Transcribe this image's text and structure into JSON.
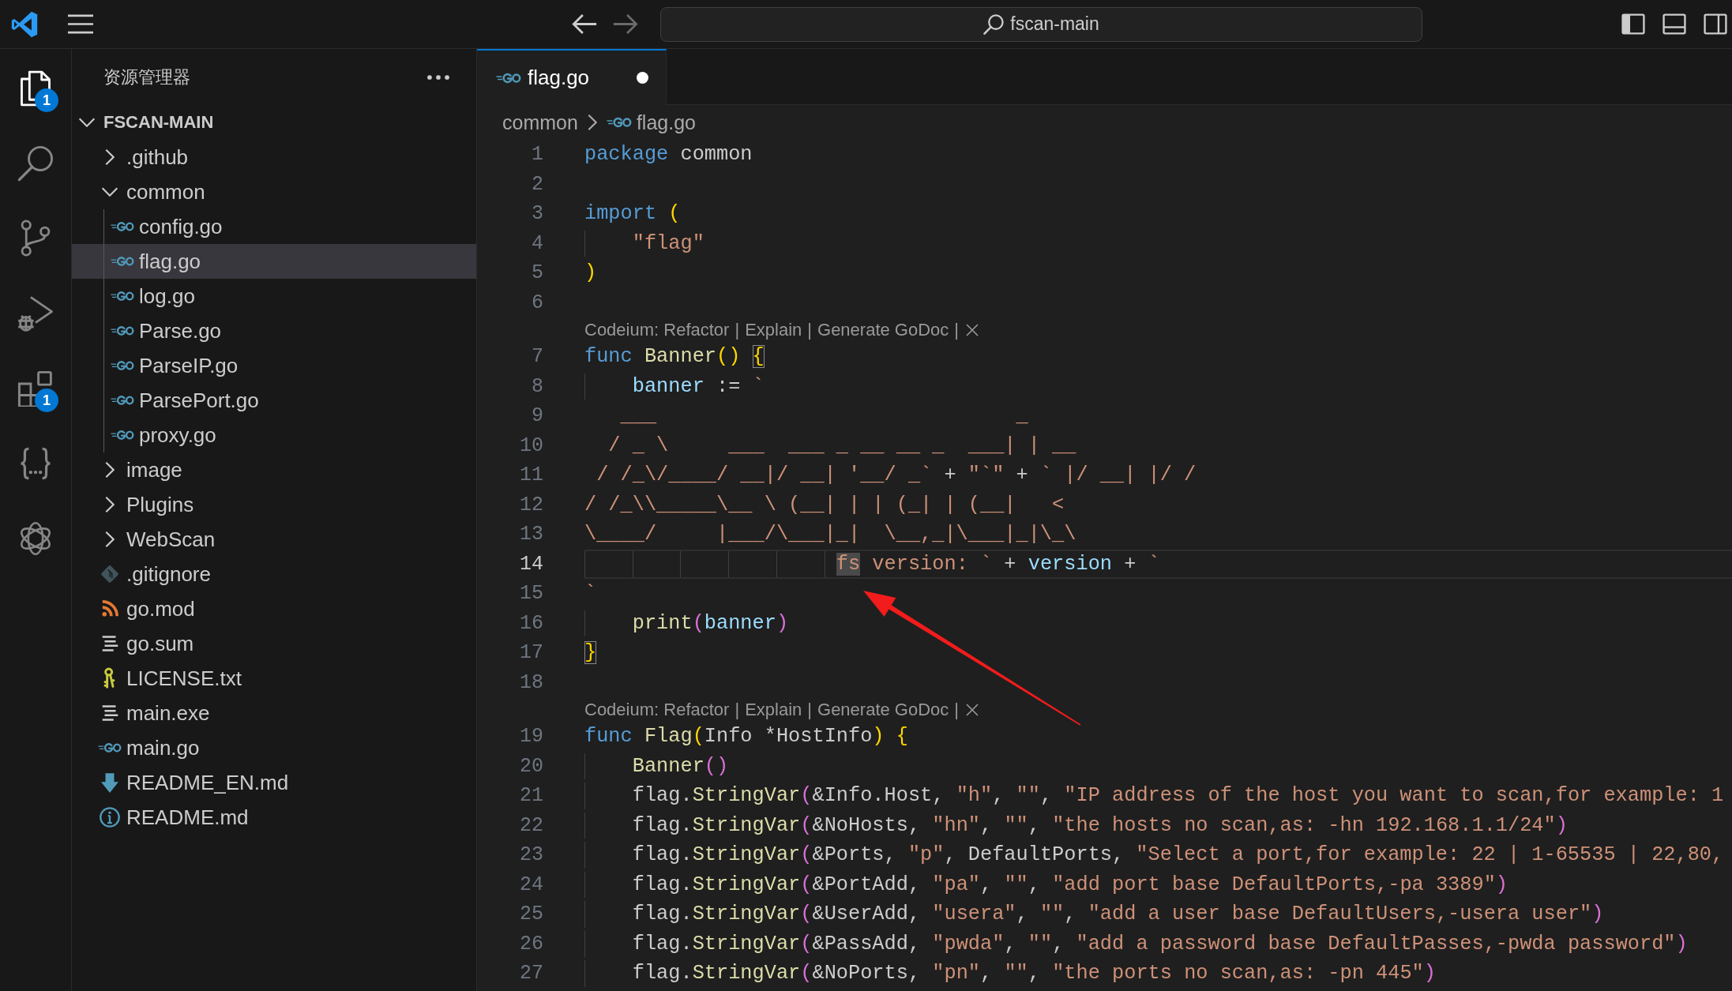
{
  "title_bar": {
    "navigation": [
      {
        "kind": "back",
        "disabled": false
      },
      {
        "kind": "forward",
        "disabled": true
      }
    ],
    "command_center": {
      "label": "fscan-main"
    },
    "layout_controls": [
      {
        "kind": "primary_sidebar",
        "on": true
      },
      {
        "kind": "panel",
        "on": false
      },
      {
        "kind": "secondary_sidebar",
        "on": false
      }
    ]
  },
  "activity_bar": {
    "items": [
      {
        "kind": "explorer",
        "selected": true,
        "badge": "1"
      },
      {
        "kind": "search",
        "selected": false
      },
      {
        "kind": "source_control",
        "selected": false
      },
      {
        "kind": "run_debug",
        "selected": false
      },
      {
        "kind": "extensions",
        "selected": false,
        "badge": "1"
      },
      {
        "kind": "braces",
        "selected": false
      },
      {
        "kind": "rings",
        "selected": false
      }
    ]
  },
  "sidebar": {
    "title": "资源管理器",
    "tree": [
      {
        "label": "FSCAN-MAIN",
        "kind": "folder",
        "expanded": true,
        "selected": false,
        "children": [
          {
            "label": ".github",
            "kind": "folder",
            "expanded": false,
            "selected": false
          },
          {
            "label": "common",
            "kind": "folder",
            "expanded": true,
            "selected": false,
            "children": [
              {
                "label": "config.go",
                "kind": "go",
                "selected": false
              },
              {
                "label": "flag.go",
                "kind": "go",
                "selected": true
              },
              {
                "label": "log.go",
                "kind": "go",
                "selected": false
              },
              {
                "label": "Parse.go",
                "kind": "go",
                "selected": false
              },
              {
                "label": "ParseIP.go",
                "kind": "go",
                "selected": false
              },
              {
                "label": "ParsePort.go",
                "kind": "go",
                "selected": false
              },
              {
                "label": "proxy.go",
                "kind": "go",
                "selected": false
              }
            ]
          },
          {
            "label": "image",
            "kind": "folder",
            "expanded": false,
            "selected": false
          },
          {
            "label": "Plugins",
            "kind": "folder",
            "expanded": false,
            "selected": false
          },
          {
            "label": "WebScan",
            "kind": "folder",
            "expanded": false,
            "selected": false
          },
          {
            "label": ".gitignore",
            "kind": "gitignore",
            "selected": false
          },
          {
            "label": "go.mod",
            "kind": "gomod",
            "selected": false
          },
          {
            "label": "go.sum",
            "kind": "text",
            "selected": false
          },
          {
            "label": "LICENSE.txt",
            "kind": "license",
            "selected": false
          },
          {
            "label": "main.exe",
            "kind": "text",
            "selected": false
          },
          {
            "label": "main.go",
            "kind": "go",
            "selected": false
          },
          {
            "label": "README_EN.md",
            "kind": "readme_download",
            "selected": false
          },
          {
            "label": "README.md",
            "kind": "readme_info",
            "selected": false
          }
        ]
      }
    ]
  },
  "editor": {
    "tabs": [
      {
        "label": "flag.go",
        "kind": "go",
        "selected": true,
        "modified": true
      }
    ],
    "breadcrumb": [
      {
        "label": "common",
        "kind": "folder"
      },
      {
        "label": "flag.go",
        "kind": "go"
      }
    ],
    "lines": [
      {
        "kind": "code",
        "number": "1",
        "active": false,
        "tokens": [
          {
            "kind": "keyword",
            "text": "package"
          },
          {
            "kind": "plain",
            "text": " common"
          }
        ]
      },
      {
        "kind": "code",
        "number": "2",
        "active": false
      },
      {
        "kind": "code",
        "number": "3",
        "active": false,
        "tokens": [
          {
            "kind": "keyword",
            "text": "import"
          },
          {
            "kind": "bracket1",
            "text": " ("
          }
        ]
      },
      {
        "kind": "code",
        "number": "4",
        "active": false,
        "tokens": [
          {
            "kind": "string",
            "text": "\t\"flag\""
          }
        ]
      },
      {
        "kind": "code",
        "number": "5",
        "active": false,
        "tokens": [
          {
            "kind": "bracket1",
            "text": ")"
          }
        ]
      },
      {
        "kind": "code",
        "number": "6",
        "active": false
      },
      {
        "kind": "codelens",
        "actions": [
          "Codeium: Refactor",
          "Explain",
          "Generate GoDoc"
        ],
        "separator": "|"
      },
      {
        "kind": "code",
        "number": "7",
        "active": false,
        "tokens": [
          {
            "kind": "keyword",
            "text": "func"
          },
          {
            "kind": "function",
            "text": " Banner"
          },
          {
            "kind": "bracket1",
            "text": "() "
          },
          {
            "kind": "bracket1",
            "text": "{",
            "bracket_match": true
          }
        ]
      },
      {
        "kind": "code",
        "number": "8",
        "active": false,
        "tokens": [
          {
            "kind": "variable",
            "text": "\tbanner"
          },
          {
            "kind": "plain",
            "text": " := "
          },
          {
            "kind": "string",
            "text": "`"
          }
        ]
      },
      {
        "kind": "code",
        "number": "9",
        "active": false,
        "tokens": [
          {
            "kind": "string",
            "text": "   ___                              _"
          }
        ]
      },
      {
        "kind": "code",
        "number": "10",
        "active": false,
        "tokens": [
          {
            "kind": "string",
            "text": "  / _ \\     ___  ___ _ __ __ _  ___| | __"
          }
        ]
      },
      {
        "kind": "code",
        "number": "11",
        "active": false,
        "tokens": [
          {
            "kind": "string",
            "text": " / /_\\/____/ __|/ __| '__/ _`"
          },
          {
            "kind": "plain",
            "text": " + "
          },
          {
            "kind": "string",
            "text": "\"`\""
          },
          {
            "kind": "plain",
            "text": " + "
          },
          {
            "kind": "string",
            "text": "` |/ __| |/ /"
          }
        ]
      },
      {
        "kind": "code",
        "number": "12",
        "active": false,
        "tokens": [
          {
            "kind": "string",
            "text": "/ /_\\\\_____\\__ \\ (__| | | (_| | (__|   <"
          }
        ]
      },
      {
        "kind": "code",
        "number": "13",
        "active": false,
        "tokens": [
          {
            "kind": "string",
            "text": "\\____/     |___/\\___|_|  \\__,_|\\___|_|\\_\\"
          }
        ]
      },
      {
        "kind": "code",
        "number": "14",
        "active": true,
        "tokens": [
          {
            "kind": "string",
            "text": "\t\t\t\t\t fs",
            "word_highlight": true
          },
          {
            "kind": "string",
            "text": " version: `"
          },
          {
            "kind": "plain",
            "text": " + "
          },
          {
            "kind": "variable",
            "text": "version"
          },
          {
            "kind": "plain",
            "text": " + "
          },
          {
            "kind": "string",
            "text": "`"
          }
        ]
      },
      {
        "kind": "code",
        "number": "15",
        "active": false,
        "tokens": [
          {
            "kind": "string",
            "text": "`"
          }
        ]
      },
      {
        "kind": "code",
        "number": "16",
        "active": false,
        "tokens": [
          {
            "kind": "function",
            "text": "\tprint"
          },
          {
            "kind": "bracket2",
            "text": "("
          },
          {
            "kind": "variable",
            "text": "banner"
          },
          {
            "kind": "bracket2",
            "text": ")"
          }
        ]
      },
      {
        "kind": "code",
        "number": "17",
        "active": false,
        "tokens": [
          {
            "kind": "bracket1",
            "text": "}",
            "bracket_match": true
          }
        ]
      },
      {
        "kind": "code",
        "number": "18",
        "active": false
      },
      {
        "kind": "codelens",
        "actions": [
          "Codeium: Refactor",
          "Explain",
          "Generate GoDoc"
        ],
        "separator": "|"
      },
      {
        "kind": "code",
        "number": "19",
        "active": false,
        "tokens": [
          {
            "kind": "keyword",
            "text": "func"
          },
          {
            "kind": "function",
            "text": " Flag"
          },
          {
            "kind": "bracket1",
            "text": "("
          },
          {
            "kind": "plain",
            "text": "Info *HostInfo"
          },
          {
            "kind": "bracket1",
            "text": ") {"
          }
        ]
      },
      {
        "kind": "code",
        "number": "20",
        "active": false,
        "tokens": [
          {
            "kind": "function",
            "text": "\tBanner"
          },
          {
            "kind": "bracket2",
            "text": "()"
          }
        ]
      },
      {
        "kind": "code",
        "number": "21",
        "active": false,
        "tokens": [
          {
            "kind": "plain",
            "text": "\tflag."
          },
          {
            "kind": "function",
            "text": "StringVar"
          },
          {
            "kind": "bracket2",
            "text": "("
          },
          {
            "kind": "plain",
            "text": "&Info.Host, "
          },
          {
            "kind": "string",
            "text": "\"h\""
          },
          {
            "kind": "plain",
            "text": ", "
          },
          {
            "kind": "string",
            "text": "\"\""
          },
          {
            "kind": "plain",
            "text": ", "
          },
          {
            "kind": "string",
            "text": "\"IP address of the host you want to scan,for example: 1"
          }
        ]
      },
      {
        "kind": "code",
        "number": "22",
        "active": false,
        "tokens": [
          {
            "kind": "plain",
            "text": "\tflag."
          },
          {
            "kind": "function",
            "text": "StringVar"
          },
          {
            "kind": "bracket2",
            "text": "("
          },
          {
            "kind": "plain",
            "text": "&NoHosts, "
          },
          {
            "kind": "string",
            "text": "\"hn\""
          },
          {
            "kind": "plain",
            "text": ", "
          },
          {
            "kind": "string",
            "text": "\"\""
          },
          {
            "kind": "plain",
            "text": ", "
          },
          {
            "kind": "string",
            "text": "\"the hosts no scan,as: -hn 192.168.1.1/24\""
          },
          {
            "kind": "bracket2",
            "text": ")"
          }
        ]
      },
      {
        "kind": "code",
        "number": "23",
        "active": false,
        "tokens": [
          {
            "kind": "plain",
            "text": "\tflag."
          },
          {
            "kind": "function",
            "text": "StringVar"
          },
          {
            "kind": "bracket2",
            "text": "("
          },
          {
            "kind": "plain",
            "text": "&Ports, "
          },
          {
            "kind": "string",
            "text": "\"p\""
          },
          {
            "kind": "plain",
            "text": ", DefaultPorts, "
          },
          {
            "kind": "string",
            "text": "\"Select a port,for example: 22 | 1-65535 | 22,80,"
          }
        ]
      },
      {
        "kind": "code",
        "number": "24",
        "active": false,
        "tokens": [
          {
            "kind": "plain",
            "text": "\tflag."
          },
          {
            "kind": "function",
            "text": "StringVar"
          },
          {
            "kind": "bracket2",
            "text": "("
          },
          {
            "kind": "plain",
            "text": "&PortAdd, "
          },
          {
            "kind": "string",
            "text": "\"pa\""
          },
          {
            "kind": "plain",
            "text": ", "
          },
          {
            "kind": "string",
            "text": "\"\""
          },
          {
            "kind": "plain",
            "text": ", "
          },
          {
            "kind": "string",
            "text": "\"add port base DefaultPorts,-pa 3389\""
          },
          {
            "kind": "bracket2",
            "text": ")"
          }
        ]
      },
      {
        "kind": "code",
        "number": "25",
        "active": false,
        "tokens": [
          {
            "kind": "plain",
            "text": "\tflag."
          },
          {
            "kind": "function",
            "text": "StringVar"
          },
          {
            "kind": "bracket2",
            "text": "("
          },
          {
            "kind": "plain",
            "text": "&UserAdd, "
          },
          {
            "kind": "string",
            "text": "\"usera\""
          },
          {
            "kind": "plain",
            "text": ", "
          },
          {
            "kind": "string",
            "text": "\"\""
          },
          {
            "kind": "plain",
            "text": ", "
          },
          {
            "kind": "string",
            "text": "\"add a user base DefaultUsers,-usera user\""
          },
          {
            "kind": "bracket2",
            "text": ")"
          }
        ]
      },
      {
        "kind": "code",
        "number": "26",
        "active": false,
        "tokens": [
          {
            "kind": "plain",
            "text": "\tflag."
          },
          {
            "kind": "function",
            "text": "StringVar"
          },
          {
            "kind": "bracket2",
            "text": "("
          },
          {
            "kind": "plain",
            "text": "&PassAdd, "
          },
          {
            "kind": "string",
            "text": "\"pwda\""
          },
          {
            "kind": "plain",
            "text": ", "
          },
          {
            "kind": "string",
            "text": "\"\""
          },
          {
            "kind": "plain",
            "text": ", "
          },
          {
            "kind": "string",
            "text": "\"add a password base DefaultPasses,-pwda password\""
          },
          {
            "kind": "bracket2",
            "text": ")"
          }
        ]
      },
      {
        "kind": "code",
        "number": "27",
        "active": false,
        "tokens": [
          {
            "kind": "plain",
            "text": "\tflag."
          },
          {
            "kind": "function",
            "text": "StringVar"
          },
          {
            "kind": "bracket2",
            "text": "("
          },
          {
            "kind": "plain",
            "text": "&NoPorts, "
          },
          {
            "kind": "string",
            "text": "\"pn\""
          },
          {
            "kind": "plain",
            "text": ", "
          },
          {
            "kind": "string",
            "text": "\"\""
          },
          {
            "kind": "plain",
            "text": ", "
          },
          {
            "kind": "string",
            "text": "\"the ports no scan,as: -pn 445\""
          },
          {
            "kind": "bracket2",
            "text": ")"
          }
        ]
      }
    ]
  }
}
